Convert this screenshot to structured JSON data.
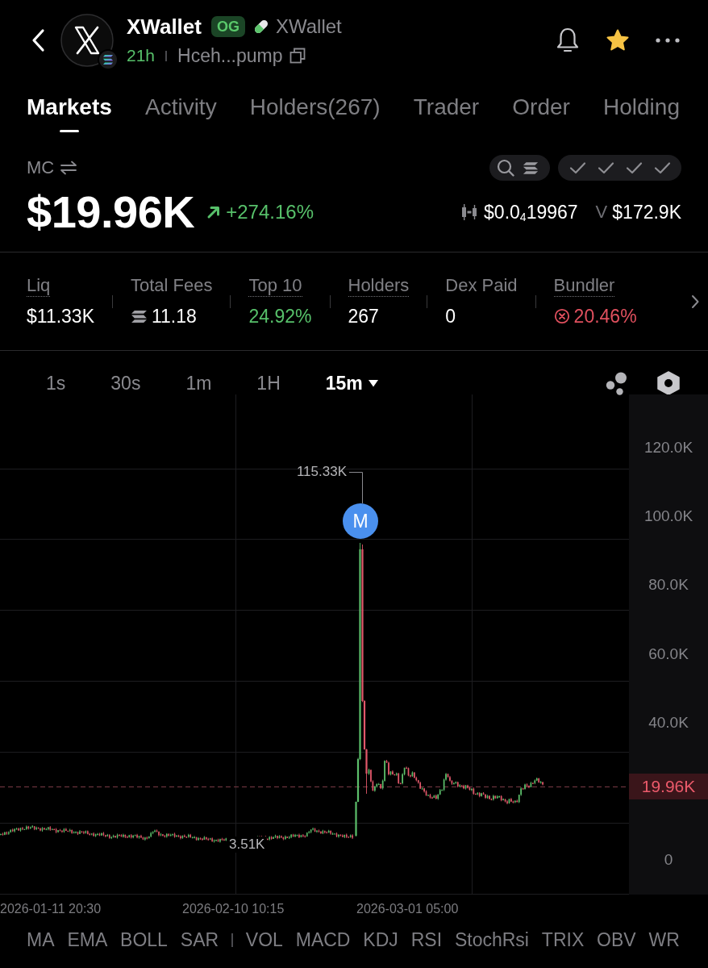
{
  "header": {
    "title": "XWallet",
    "badge": "OG",
    "ticker": "XWallet",
    "age": "21h",
    "address": "Hceh...pump",
    "starred": true
  },
  "tabs": [
    {
      "label": "Markets",
      "selected": true
    },
    {
      "label": "Activity",
      "selected": false
    },
    {
      "label": "Holders(267)",
      "selected": false
    },
    {
      "label": "Trader",
      "selected": false
    },
    {
      "label": "Order",
      "selected": false
    },
    {
      "label": "Holding",
      "selected": false
    }
  ],
  "market": {
    "label": "MC",
    "value": "$19.96K",
    "change": "+274.16%",
    "price": "$0.0$_{4}$19967",
    "volume_label": "V",
    "volume": "$172.9K",
    "checks": [
      {
        "passed": true
      },
      {
        "passed": true
      },
      {
        "passed": true
      },
      {
        "passed": true
      }
    ]
  },
  "stats": [
    {
      "label": "Liq",
      "value": "$11.33K",
      "kind": "plain",
      "dotted": true
    },
    {
      "label": "Total Fees",
      "value": "11.18",
      "kind": "token",
      "dotted": false
    },
    {
      "label": "Top 10",
      "value": "24.92%",
      "kind": "positive",
      "dotted": true
    },
    {
      "label": "Holders",
      "value": "267",
      "kind": "plain",
      "dotted": true
    },
    {
      "label": "Dex Paid",
      "value": "0",
      "kind": "plain",
      "dotted": false
    },
    {
      "label": "Bundler",
      "value": "20.46%",
      "kind": "alert",
      "dotted": true
    }
  ],
  "intervals": [
    {
      "label": "1s",
      "selected": false
    },
    {
      "label": "30s",
      "selected": false
    },
    {
      "label": "1m",
      "selected": false
    },
    {
      "label": "1H",
      "selected": false
    },
    {
      "label": "15m",
      "selected": true
    }
  ],
  "chart": {
    "y_labels": [
      "120.0K",
      "100.0K",
      "80.0K",
      "60.0K",
      "40.0K",
      "0"
    ],
    "last_price": "19.96K",
    "high": "115.33K",
    "low": "3.51K",
    "marker": "M",
    "x_labels": [
      "2026-01-11 20:30",
      "2026-02-10 10:15",
      "2026-03-01 05:00"
    ]
  },
  "indicator_groups": [
    [
      "MA",
      "EMA",
      "BOLL",
      "SAR"
    ],
    [
      "VOL",
      "MACD",
      "KDJ",
      "RSI",
      "StochRsi",
      "TRIX",
      "OBV",
      "WR"
    ]
  ]
}
